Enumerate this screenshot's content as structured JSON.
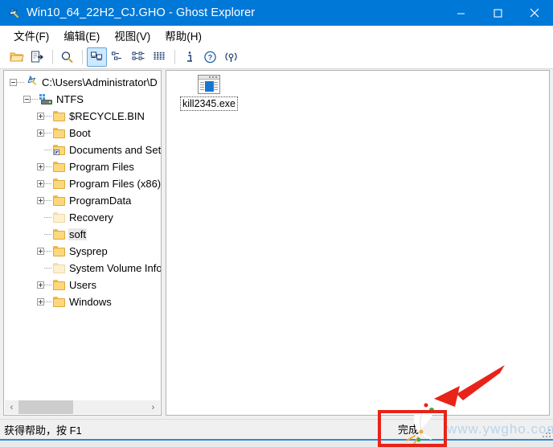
{
  "window": {
    "title": "Win10_64_22H2_CJ.GHO - Ghost Explorer",
    "app_icon": "ghost-icon",
    "titlebar_color": "#0078d7",
    "controls": {
      "minimize": "minimize-icon",
      "maximize": "maximize-icon",
      "close": "close-icon"
    }
  },
  "menubar": {
    "items": [
      {
        "label": "文件(F)"
      },
      {
        "label": "编辑(E)"
      },
      {
        "label": "视图(V)"
      },
      {
        "label": "帮助(H)"
      }
    ]
  },
  "toolbar": {
    "buttons": [
      {
        "name": "open-folder-icon",
        "selected": false
      },
      {
        "name": "extract-icon",
        "selected": false
      },
      {
        "name": "search-icon",
        "selected": false
      },
      {
        "name": "view-large-icons-icon",
        "selected": true
      },
      {
        "name": "view-small-icons-icon",
        "selected": false
      },
      {
        "name": "view-list-icon",
        "selected": false
      },
      {
        "name": "view-details-icon",
        "selected": false
      },
      {
        "name": "info-icon",
        "selected": false
      },
      {
        "name": "help-icon",
        "selected": false
      },
      {
        "name": "about-icon",
        "selected": false
      }
    ]
  },
  "tree": {
    "nodes": [
      {
        "label": "C:\\Users\\Administrator\\D",
        "indent": 0,
        "expander": "minus",
        "icon": "ghost-icon",
        "selected": false
      },
      {
        "label": "NTFS",
        "indent": 1,
        "expander": "minus",
        "icon": "drive-icon",
        "selected": false
      },
      {
        "label": "$RECYCLE.BIN",
        "indent": 2,
        "expander": "plus",
        "icon": "folder-icon",
        "selected": false
      },
      {
        "label": "Boot",
        "indent": 2,
        "expander": "plus",
        "icon": "folder-icon",
        "selected": false
      },
      {
        "label": "Documents and Set",
        "indent": 2,
        "expander": "none",
        "icon": "folder-shortcut-icon",
        "selected": false
      },
      {
        "label": "Program Files",
        "indent": 2,
        "expander": "plus",
        "icon": "folder-icon",
        "selected": false
      },
      {
        "label": "Program Files (x86)",
        "indent": 2,
        "expander": "plus",
        "icon": "folder-icon",
        "selected": false
      },
      {
        "label": "ProgramData",
        "indent": 2,
        "expander": "plus",
        "icon": "folder-icon",
        "selected": false
      },
      {
        "label": "Recovery",
        "indent": 2,
        "expander": "none",
        "icon": "folder-pale-icon",
        "selected": false
      },
      {
        "label": "soft",
        "indent": 2,
        "expander": "none",
        "icon": "folder-icon",
        "selected": true
      },
      {
        "label": "Sysprep",
        "indent": 2,
        "expander": "plus",
        "icon": "folder-icon",
        "selected": false
      },
      {
        "label": "System Volume Info",
        "indent": 2,
        "expander": "none",
        "icon": "folder-pale-icon",
        "selected": false
      },
      {
        "label": "Users",
        "indent": 2,
        "expander": "plus",
        "icon": "folder-icon",
        "selected": false
      },
      {
        "label": "Windows",
        "indent": 2,
        "expander": "plus",
        "icon": "folder-icon",
        "selected": false
      }
    ],
    "hscroll": {
      "left_arrow": "‹",
      "right_arrow": "›"
    }
  },
  "list": {
    "files": [
      {
        "name": "kill2345.exe",
        "icon": "exe-file-icon",
        "selected": true
      }
    ]
  },
  "statusbar": {
    "text": "获得帮助，按 F1"
  },
  "annotations": {
    "finish_button_label": "完成",
    "highlight_color": "#e8231a",
    "arrow_color": "#e8231a",
    "watermark": "www.ywgho.com"
  }
}
